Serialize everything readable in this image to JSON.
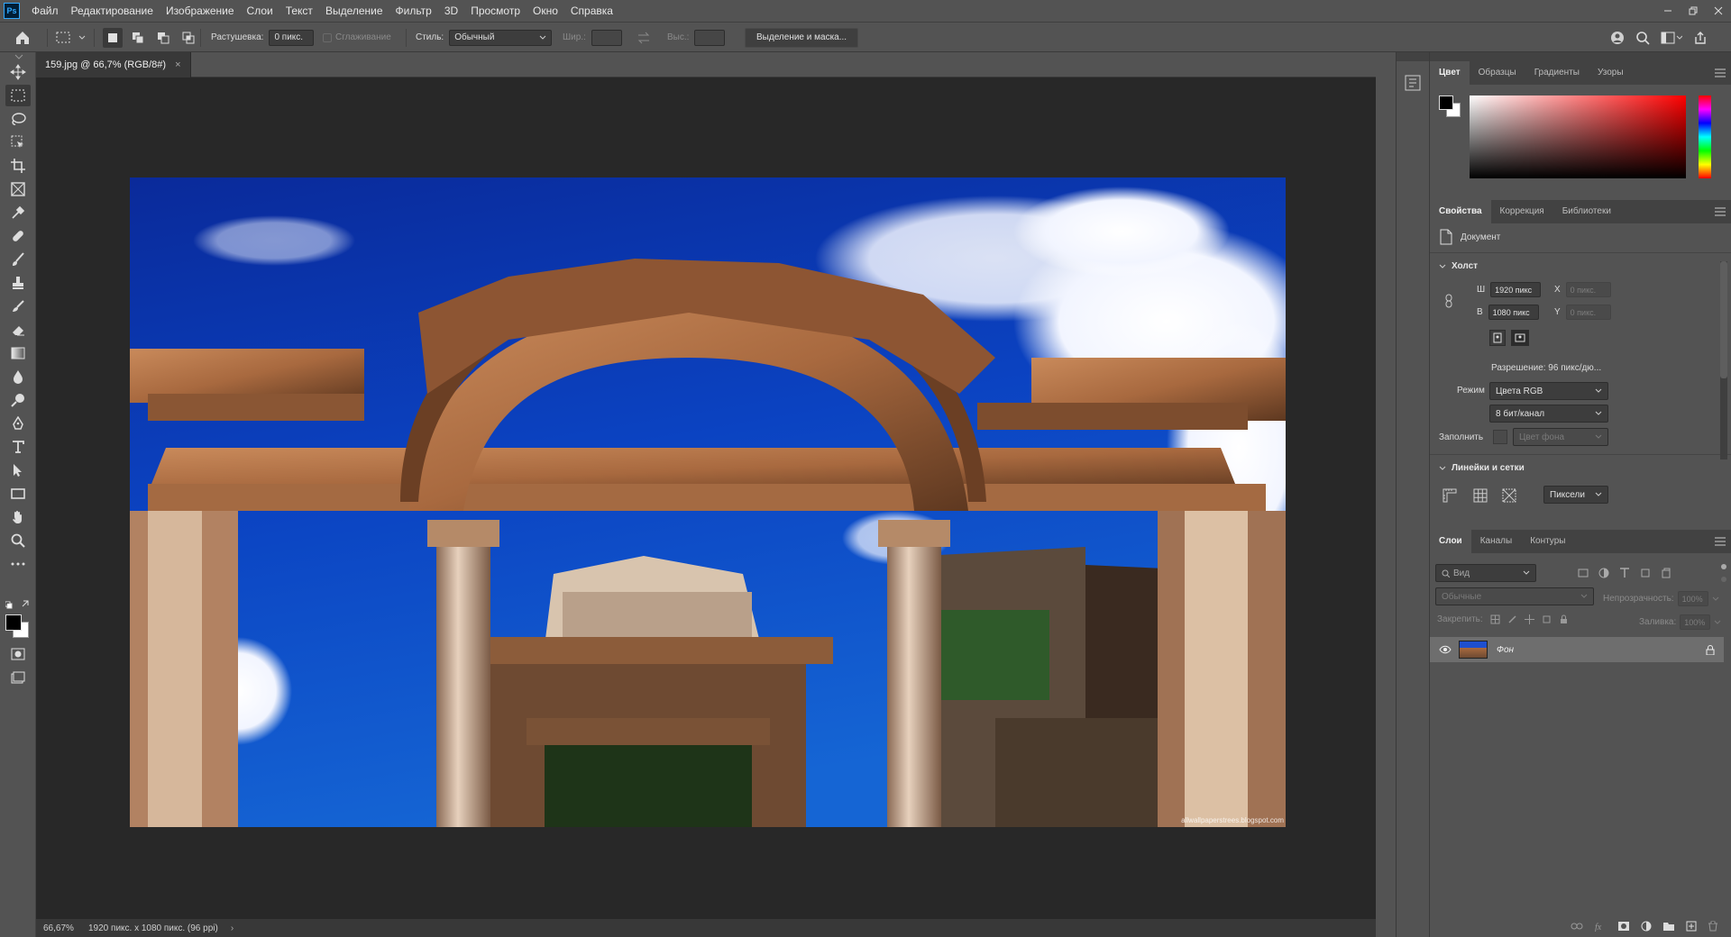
{
  "app": {
    "logo": "Ps",
    "accent": "#31a8ff"
  },
  "menu": [
    "Файл",
    "Редактирование",
    "Изображение",
    "Слои",
    "Текст",
    "Выделение",
    "Фильтр",
    "3D",
    "Просмотр",
    "Окно",
    "Справка"
  ],
  "options": {
    "feather_label": "Растушевка:",
    "feather_value": "0 пикс.",
    "antialias_label": "Сглаживание",
    "style_label": "Стиль:",
    "style_value": "Обычный",
    "width_label": "Шир.:",
    "height_label": "Выс.:",
    "mask_button": "Выделение и маска..."
  },
  "document": {
    "tab_title": "159.jpg @ 66,7% (RGB/8#)",
    "close": "×",
    "watermark": "allwallpaperstrees.blogspot.com"
  },
  "status": {
    "zoom": "66,67%",
    "info": "1920 пикс. x 1080 пикс. (96 ppi)",
    "arrow": "›"
  },
  "color_panel": {
    "tabs": [
      "Цвет",
      "Образцы",
      "Градиенты",
      "Узоры"
    ],
    "active": "Цвет",
    "foreground": "#000000",
    "background": "#ffffff",
    "hue": "#ff0000"
  },
  "properties_panel": {
    "tabs": [
      "Свойства",
      "Коррекция",
      "Библиотеки"
    ],
    "active": "Свойства",
    "doc_label": "Документ",
    "canvas_header": "Холст",
    "w_label": "Ш",
    "w_value": "1920 пикс",
    "h_label": "В",
    "h_value": "1080 пикс",
    "x_label": "X",
    "x_placeholder": "0 пикс.",
    "y_label": "Y",
    "y_placeholder": "0 пикс.",
    "resolution": "Разрешение: 96 пикс/дю...",
    "mode_label": "Режим",
    "mode_value": "Цвета RGB",
    "bit_value": "8 бит/канал",
    "fill_label": "Заполнить",
    "fill_value": "Цвет фона",
    "rulers_header": "Линейки и сетки",
    "units_value": "Пиксели"
  },
  "layers_panel": {
    "tabs": [
      "Слои",
      "Каналы",
      "Контуры"
    ],
    "active": "Слои",
    "search_placeholder": "Вид",
    "blend_mode": "Обычные",
    "opacity_label": "Непрозрачность:",
    "opacity_value": "100%",
    "lock_label": "Закрепить:",
    "fill_label": "Заливка:",
    "fill_value": "100%",
    "layers": [
      {
        "name": "Фон",
        "visible": true,
        "locked": true
      }
    ]
  }
}
